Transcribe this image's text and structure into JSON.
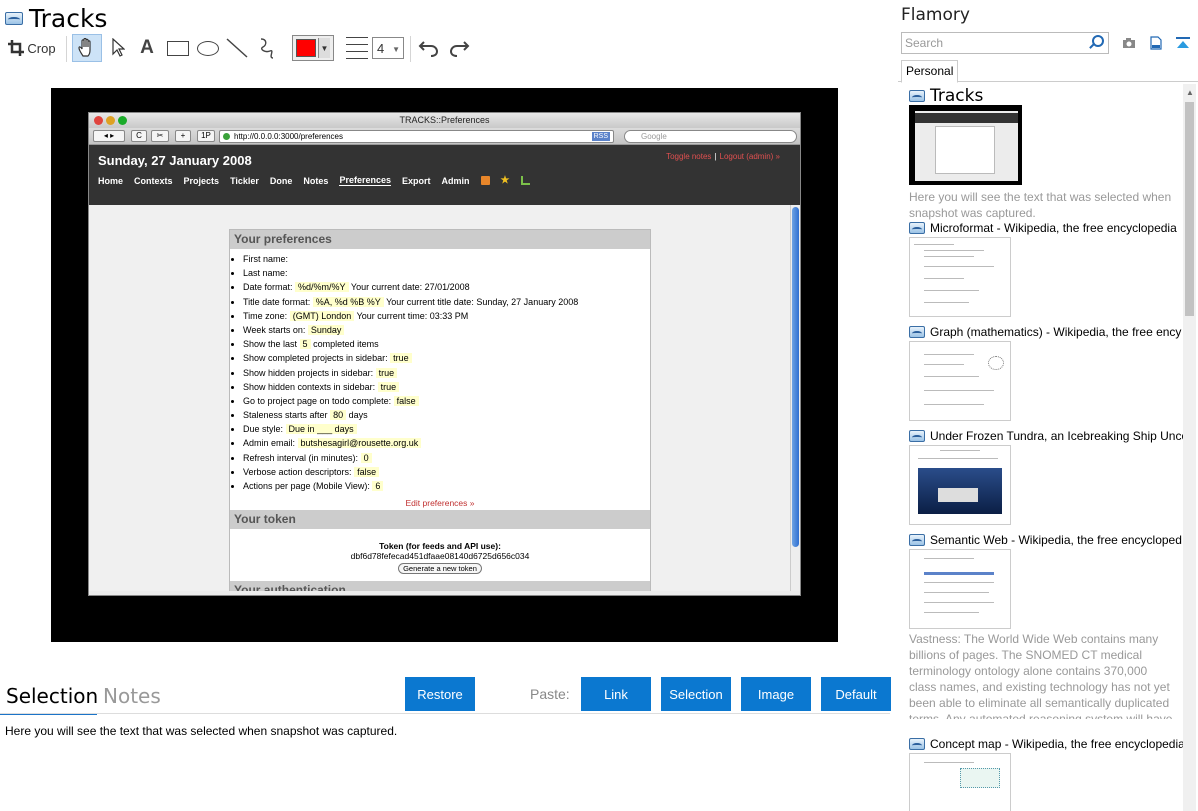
{
  "app": {
    "title": "Tracks"
  },
  "toolbar": {
    "crop_label": "Crop",
    "line_width": "4",
    "color": "#ff0000"
  },
  "screenshot": {
    "window_title": "TRACKS::Preferences",
    "url": "http://0.0.0.0:3000/preferences",
    "rss": "RSS",
    "search_placeholder": "Google",
    "nav_buttons": [
      "◂ ▸",
      "C",
      "✂",
      "+",
      "1P"
    ],
    "date": "Sunday, 27 January 2008",
    "toggle_notes": "Toggle notes",
    "separator": "|",
    "logout": "Logout (admin) »",
    "menu": [
      "Home",
      "Contexts",
      "Projects",
      "Tickler",
      "Done",
      "Notes",
      "Preferences",
      "Export",
      "Admin"
    ],
    "prefs_heading": "Your preferences",
    "prefs": [
      {
        "label": "First name:",
        "value": ""
      },
      {
        "label": "Last name:",
        "value": ""
      },
      {
        "label": "Date format:",
        "value": "%d/%m/%Y",
        "extra": "Your current date: 27/01/2008"
      },
      {
        "label": "Title date format:",
        "value": "%A, %d %B %Y",
        "extra": "Your current title date: Sunday, 27 January 2008"
      },
      {
        "label": "Time zone:",
        "value": "(GMT) London",
        "extra": "Your current time: 03:33 PM"
      },
      {
        "label": "Week starts on:",
        "value": "Sunday"
      },
      {
        "label": "Show the last",
        "value": "5",
        "extra": "completed items"
      },
      {
        "label": "Show completed projects in sidebar:",
        "value": "true"
      },
      {
        "label": "Show hidden projects in sidebar:",
        "value": "true"
      },
      {
        "label": "Show hidden contexts in sidebar:",
        "value": "true"
      },
      {
        "label": "Go to project page on todo complete:",
        "value": "false"
      },
      {
        "label": "Staleness starts after",
        "value": "80",
        "extra": "days"
      },
      {
        "label": "Due style:",
        "value": "Due in ___ days"
      },
      {
        "label": "Admin email:",
        "value": "butshesagirl@rousette.org.uk"
      },
      {
        "label": "Refresh interval (in minutes):",
        "value": "0"
      },
      {
        "label": "Verbose action descriptors:",
        "value": "false"
      },
      {
        "label": "Actions per page (Mobile View):",
        "value": "6"
      }
    ],
    "edit_prefs": "Edit preferences »",
    "token_heading": "Your token",
    "token_label": "Token (for feeds and API use):",
    "token_value": "dbf6d78fefecad451dfaae08140d6725d656c034",
    "generate_token": "Generate a new token",
    "auth_heading": "Your authentication"
  },
  "bottom": {
    "tab_selection": "Selection",
    "tab_notes": "Notes",
    "restore": "Restore",
    "paste_label": "Paste:",
    "paste_link": "Link",
    "paste_selection": "Selection",
    "paste_image": "Image",
    "paste_default": "Default",
    "selection_text": "Here you will see the text that was selected when snapshot was captured."
  },
  "sidebar": {
    "title": "Flamory",
    "search_placeholder": "Search",
    "tab": "Personal",
    "items": [
      {
        "title": "Tracks",
        "desc": "Here you will see the text that was selected when snapshot was captured."
      },
      {
        "title": "Microformat - Wikipedia, the free encyclopedia"
      },
      {
        "title": "Graph (mathematics) - Wikipedia, the free ency"
      },
      {
        "title": "Under Frozen Tundra, an Icebreaking Ship Unco"
      },
      {
        "title": "Semantic Web - Wikipedia, the free encycloped",
        "desc": "Vastness: The World Wide Web contains many billions of pages. The SNOMED CT medical terminology ontology alone contains 370,000 class names, and existing technology has not yet been able to eliminate all semantically duplicated terms. Any automated reasoning system will have to deal with truly huge inputs."
      },
      {
        "title": "Concept map - Wikipedia, the free encyclopedia"
      }
    ]
  },
  "colors": {
    "accent": "#0b78d0",
    "tracks_header": "#333333",
    "highlight": "#ffffcc"
  }
}
